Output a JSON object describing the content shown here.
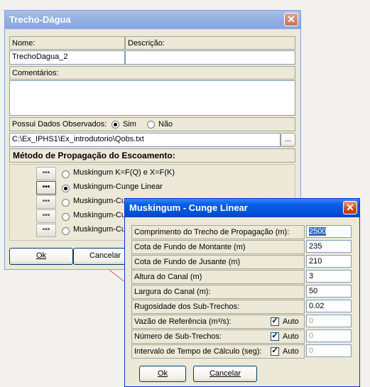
{
  "trecho": {
    "title": "Trecho-Dágua",
    "close_glyph": "✕",
    "nome_label": "Nome:",
    "descricao_label": "Descrição:",
    "nome_value": "TrechoDagua_2",
    "descricao_value": "",
    "comentarios_label": "Comentários:",
    "comentarios_value": "",
    "observados_label": "Possui Dados Observados:",
    "sim_label": "Sim",
    "nao_label": "Não",
    "observados_selected": "Sim",
    "file_path": "C:\\Ex_IPHS1\\Ex_introdutorio\\Qobs.txt",
    "browse_label": "...",
    "metodo_heading": "Método de Propagação do Escoamento:",
    "dots_label": "•••",
    "methods": [
      {
        "label": "Muskingum K=F(Q) e X=F(K)",
        "selected": false
      },
      {
        "label": "Muskingum-Cunge Linear",
        "selected": true
      },
      {
        "label": "Muskingum-Cu",
        "selected": false
      },
      {
        "label": "Muskingum-Cu",
        "selected": false
      },
      {
        "label": "Muskingum-Cu",
        "selected": false
      }
    ],
    "ok_label": "Ok",
    "cancel_label": "Cancelar"
  },
  "cunge": {
    "title": "Muskingum - Cunge Linear",
    "close_glyph": "✕",
    "auto_label": "Auto",
    "check_glyph": "✓",
    "rows": [
      {
        "label": "Comprimento do Trecho de Propagação (m):",
        "value": "2500"
      },
      {
        "label": "Cota de Fundo de Montante (m)",
        "value": "235"
      },
      {
        "label": "Cota de Fundo de Jusante (m)",
        "value": "210"
      },
      {
        "label": "Altura do Canal (m)",
        "value": "3"
      },
      {
        "label": "Largura do Canal (m):",
        "value": "50"
      },
      {
        "label": "Rugosidade dos Sub-Trechos:",
        "value": "0.02"
      },
      {
        "label": "Vazão de Referência (m³/s):",
        "value": "0",
        "auto": true
      },
      {
        "label": "Número de Sub-Trechos:",
        "value": "0",
        "auto": true
      },
      {
        "label": "Intervalo de Tempo de Cálculo (seg):",
        "value": "0",
        "auto": true
      }
    ],
    "ok_label": "Ok",
    "cancel_label": "Cancelar"
  },
  "colors": {
    "active_title": "#0351dc",
    "inactive_title": "#94b0e3",
    "dialog_face": "#ece9d8"
  }
}
